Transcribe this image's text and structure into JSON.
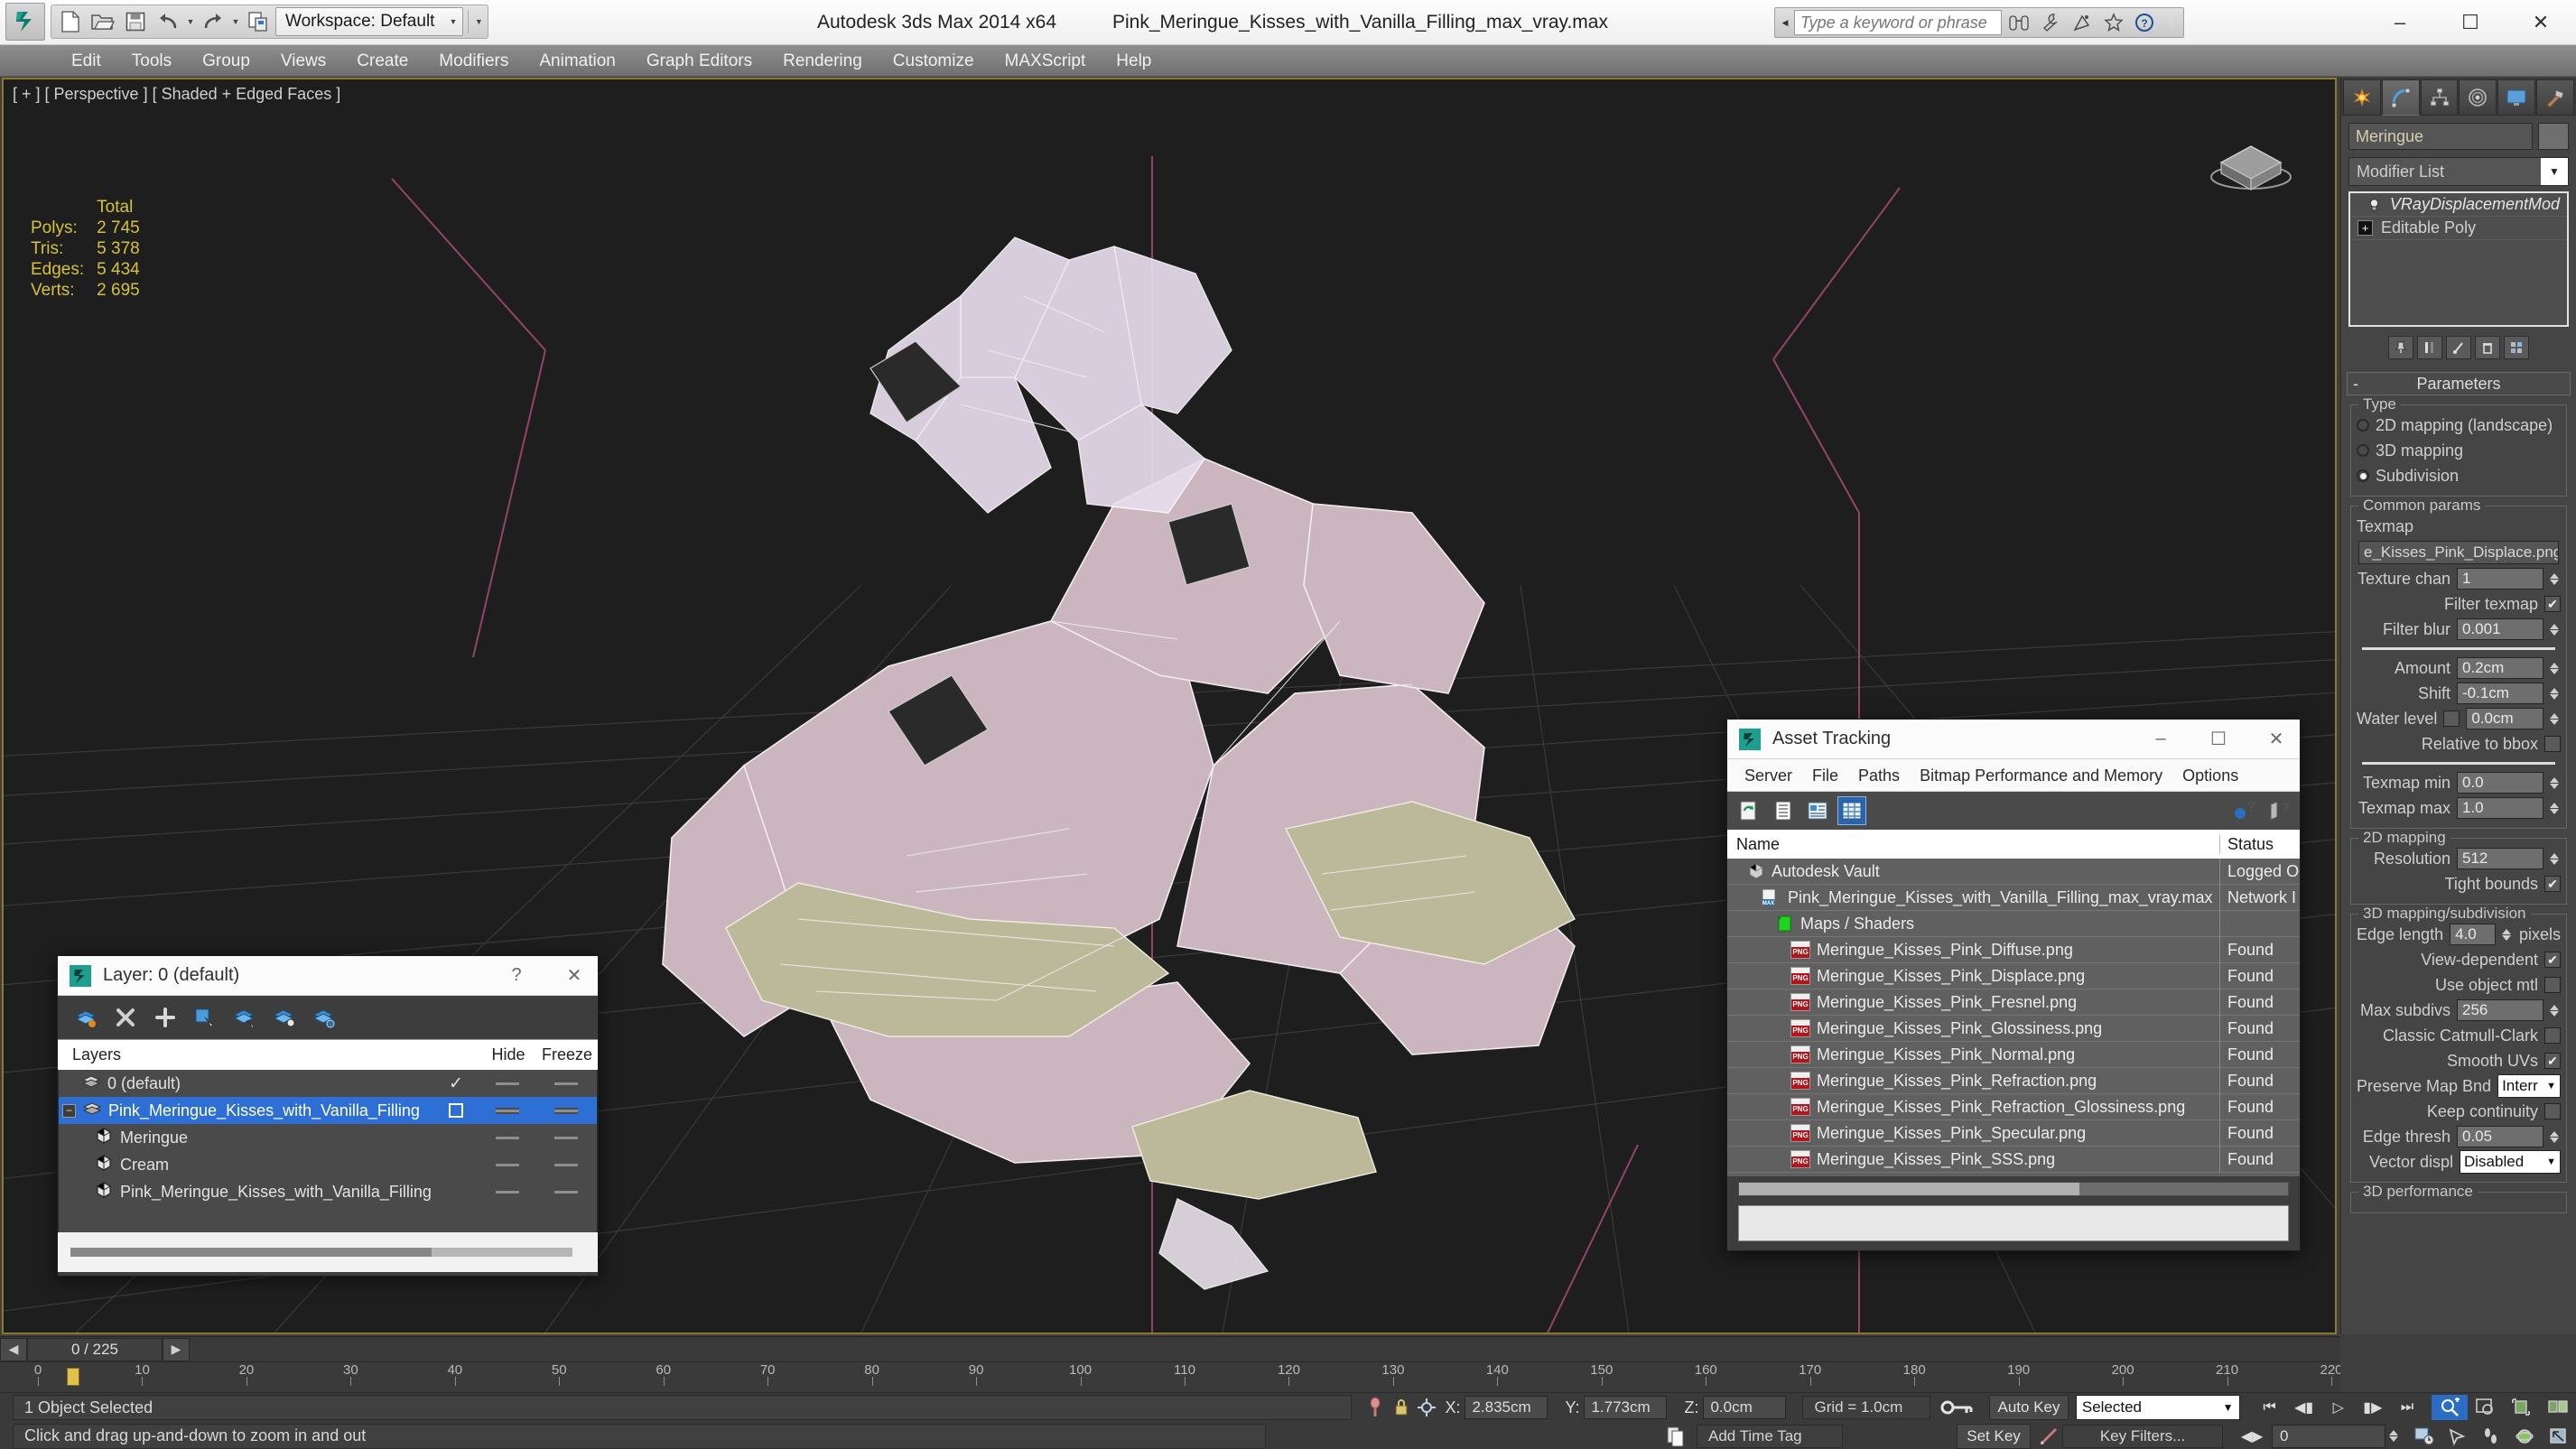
{
  "titlebar": {
    "app_title": "Autodesk 3ds Max  2014 x64",
    "file_title": "Pink_Meringue_Kisses_with_Vanilla_Filling_max_vray.max",
    "workspace_label": "Workspace: Default",
    "search_placeholder": "Type a keyword or phrase",
    "quick_access": [
      {
        "name": "new-file-icon",
        "tip": "New"
      },
      {
        "name": "open-file-icon",
        "tip": "Open"
      },
      {
        "name": "save-file-icon",
        "tip": "Save"
      },
      {
        "name": "undo-icon",
        "tip": "Undo"
      },
      {
        "name": "redo-icon",
        "tip": "Redo"
      },
      {
        "name": "project-folder-icon",
        "tip": "Set Project Folder"
      }
    ],
    "help_icons": [
      "binoculars-icon",
      "wrench-icon",
      "satellite-icon",
      "star-icon",
      "help-icon"
    ],
    "window_buttons": {
      "minimize": "–",
      "maximize": "☐",
      "close": "✕"
    }
  },
  "menubar": {
    "items": [
      "Edit",
      "Tools",
      "Group",
      "Views",
      "Create",
      "Modifiers",
      "Animation",
      "Graph Editors",
      "Rendering",
      "Customize",
      "MAXScript",
      "Help"
    ]
  },
  "viewport": {
    "label": "[ + ] [ Perspective ] [ Shaded + Edged Faces ]",
    "stats": {
      "header": "Total",
      "rows": [
        {
          "label": "Polys:",
          "value": "2 745"
        },
        {
          "label": "Tris:",
          "value": "5 378"
        },
        {
          "label": "Edges:",
          "value": "5 434"
        },
        {
          "label": "Verts:",
          "value": "2 695"
        }
      ]
    }
  },
  "layer_dialog": {
    "title": "Layer: 0 (default)",
    "help_btn": "?",
    "close_btn": "✕",
    "toolbar_icons": [
      "layer-create-icon",
      "layer-delete-icon",
      "layer-add-icon",
      "layer-select-object-icon",
      "layer-select-highlight-icon",
      "layer-highlight-selected-icon",
      "layer-settings-icon"
    ],
    "columns": {
      "name": "Layers",
      "hide": "Hide",
      "freeze": "Freeze"
    },
    "rows": [
      {
        "name": "0 (default)",
        "indent": 1,
        "icon": "layer-icon",
        "selected": false,
        "current": true,
        "expander": false
      },
      {
        "name": "Pink_Meringue_Kisses_with_Vanilla_Filling",
        "indent": 0,
        "icon": "layer-icon",
        "selected": true,
        "current": false,
        "expander": true
      },
      {
        "name": "Meringue",
        "indent": 2,
        "icon": "object-icon",
        "selected": false,
        "current": false,
        "expander": false
      },
      {
        "name": "Cream",
        "indent": 2,
        "icon": "object-icon",
        "selected": false,
        "current": false,
        "expander": false
      },
      {
        "name": "Pink_Meringue_Kisses_with_Vanilla_Filling",
        "indent": 2,
        "icon": "object-icon",
        "selected": false,
        "current": false,
        "expander": false
      }
    ]
  },
  "asset_dialog": {
    "title": "Asset Tracking",
    "window_buttons": {
      "minimize": "–",
      "maximize": "☐",
      "close": "✕"
    },
    "menu": [
      "Server",
      "File",
      "Paths",
      "Bitmap Performance and Memory",
      "Options"
    ],
    "toolbar_icons": [
      "refresh-icon",
      "list-view-icon",
      "detail-view-icon",
      "grid-view-icon"
    ],
    "help_icons": [
      "help-new-icon",
      "help-icon"
    ],
    "columns": {
      "name": "Name",
      "status": "Status"
    },
    "rows": [
      {
        "name": "Autodesk Vault",
        "status": "Logged O",
        "indent": 1,
        "icon": "vault-icon"
      },
      {
        "name": "Pink_Meringue_Kisses_with_Vanilla_Filling_max_vray.max",
        "status": "Network I",
        "indent": 2,
        "icon": "max-file-icon"
      },
      {
        "name": "Maps / Shaders",
        "status": "",
        "indent": 3,
        "icon": "maps-shaders-icon"
      },
      {
        "name": "Meringue_Kisses_Pink_Diffuse.png",
        "status": "Found",
        "indent": 4,
        "icon": "png-icon"
      },
      {
        "name": "Meringue_Kisses_Pink_Displace.png",
        "status": "Found",
        "indent": 4,
        "icon": "png-icon"
      },
      {
        "name": "Meringue_Kisses_Pink_Fresnel.png",
        "status": "Found",
        "indent": 4,
        "icon": "png-icon"
      },
      {
        "name": "Meringue_Kisses_Pink_Glossiness.png",
        "status": "Found",
        "indent": 4,
        "icon": "png-icon"
      },
      {
        "name": "Meringue_Kisses_Pink_Normal.png",
        "status": "Found",
        "indent": 4,
        "icon": "png-icon"
      },
      {
        "name": "Meringue_Kisses_Pink_Refraction.png",
        "status": "Found",
        "indent": 4,
        "icon": "png-icon"
      },
      {
        "name": "Meringue_Kisses_Pink_Refraction_Glossiness.png",
        "status": "Found",
        "indent": 4,
        "icon": "png-icon"
      },
      {
        "name": "Meringue_Kisses_Pink_Specular.png",
        "status": "Found",
        "indent": 4,
        "icon": "png-icon"
      },
      {
        "name": "Meringue_Kisses_Pink_SSS.png",
        "status": "Found",
        "indent": 4,
        "icon": "png-icon"
      }
    ]
  },
  "command_panel": {
    "tabs": [
      "create-tab-icon",
      "modify-tab-icon",
      "hierarchy-tab-icon",
      "motion-tab-icon",
      "display-tab-icon",
      "utilities-tab-icon"
    ],
    "active_tab_index": 1,
    "object_name": "Meringue",
    "modifier_list_label": "Modifier List",
    "stack": [
      {
        "label": "VRayDisplacementMod",
        "italic": true,
        "icon": "bulb-icon"
      },
      {
        "label": "Editable Poly",
        "italic": false,
        "icon": "plus-expander"
      }
    ],
    "rollout_title": "Parameters",
    "type_group": {
      "title": "Type",
      "options": [
        {
          "label": "2D mapping (landscape)",
          "checked": false
        },
        {
          "label": "3D mapping",
          "checked": false
        },
        {
          "label": "Subdivision",
          "checked": true
        }
      ]
    },
    "common_params": {
      "title": "Common params",
      "texmap_label": "Texmap",
      "texmap_value": "e_Kisses_Pink_Displace.png)",
      "texture_chan_label": "Texture chan",
      "texture_chan_value": "1",
      "filter_texmap_label": "Filter texmap",
      "filter_texmap_checked": true,
      "filter_blur_label": "Filter blur",
      "filter_blur_value": "0.001",
      "amount_label": "Amount",
      "amount_value": "0.2cm",
      "shift_label": "Shift",
      "shift_value": "-0.1cm",
      "water_level_label": "Water level",
      "water_level_checked": false,
      "water_level_value": "0.0cm",
      "relative_bbox_label": "Relative to bbox",
      "relative_bbox_checked": false,
      "texmap_min_label": "Texmap min",
      "texmap_min_value": "0.0",
      "texmap_max_label": "Texmap max",
      "texmap_max_value": "1.0"
    },
    "mapping_2d": {
      "title": "2D mapping",
      "resolution_label": "Resolution",
      "resolution_value": "512",
      "tight_bounds_label": "Tight bounds",
      "tight_bounds_checked": true
    },
    "mapping_3d": {
      "title": "3D mapping/subdivision",
      "edge_length_label": "Edge length",
      "edge_length_value": "4.0",
      "edge_length_units": "pixels",
      "view_dependent_label": "View-dependent",
      "view_dependent_checked": true,
      "use_object_mtl_label": "Use object mtl",
      "use_object_mtl_checked": false,
      "max_subdivs_label": "Max subdivs",
      "max_subdivs_value": "256",
      "classic_cc_label": "Classic Catmull-Clark",
      "classic_cc_checked": false,
      "smooth_uvs_label": "Smooth UVs",
      "smooth_uvs_checked": true,
      "preserve_map_label": "Preserve Map Bnd",
      "preserve_map_value": "Interr",
      "keep_continuity_label": "Keep continuity",
      "keep_continuity_checked": false,
      "edge_thresh_label": "Edge thresh",
      "edge_thresh_value": "0.05",
      "vector_displ_label": "Vector displ",
      "vector_displ_value": "Disabled"
    },
    "performance_3d": {
      "title": "3D performance"
    }
  },
  "timeline": {
    "current_frame_label": "0 / 225",
    "ticks": [
      0,
      10,
      20,
      30,
      40,
      50,
      60,
      70,
      80,
      90,
      100,
      110,
      120,
      130,
      140,
      150,
      160,
      170,
      180,
      190,
      200,
      210,
      220
    ]
  },
  "statusbar": {
    "selection_text": "1 Object Selected",
    "prompt_text": "Click and drag up-and-down to zoom in and out",
    "coords": {
      "x_label": "X:",
      "x_value": "2.835cm",
      "y_label": "Y:",
      "y_value": "1.773cm",
      "z_label": "Z:",
      "z_value": "0.0cm"
    },
    "grid_text": "Grid = 1.0cm",
    "add_time_tag": "Add Time Tag",
    "auto_key": "Auto Key",
    "set_key": "Set Key",
    "key_filters": "Key Filters...",
    "selected_combo": "Selected",
    "frame_value": "0",
    "icons": [
      "lock-selection-icon",
      "pin-icon",
      "absolute-mode-icon",
      "key-mode-icon",
      "zoom-region-icon",
      "pan-icon",
      "orbit-icon",
      "maximize-viewport-icon"
    ]
  }
}
